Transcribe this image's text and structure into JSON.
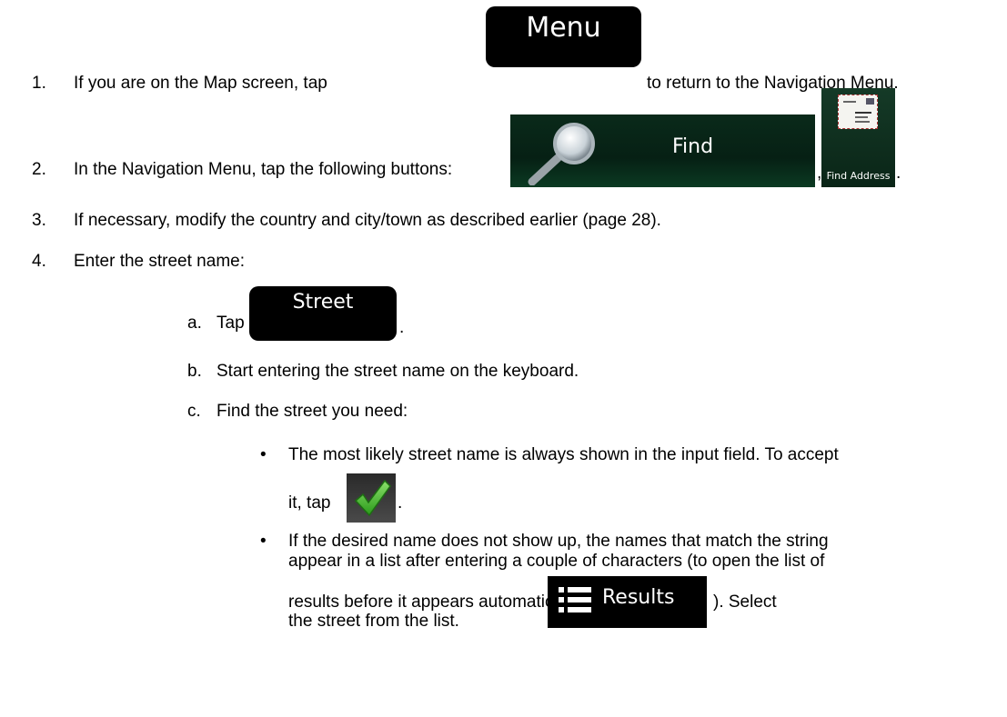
{
  "steps": [
    {
      "num": "1.",
      "before": "If you are on the Map screen, tap",
      "after": "to return to the Navigation Menu."
    },
    {
      "num": "2.",
      "before": "In the Navigation Menu, tap the following buttons:",
      "sep": ",",
      "end": "."
    },
    {
      "num": "3.",
      "text": "If necessary, modify the country and city/town as described earlier (page 28)."
    },
    {
      "num": "4.",
      "text": "Enter the street name:"
    }
  ],
  "substeps": [
    {
      "letter": "a.",
      "before": "Tap",
      "end": "."
    },
    {
      "letter": "b.",
      "text": "Start entering the street name on the keyboard."
    },
    {
      "letter": "c.",
      "text": "Find the street you need:"
    }
  ],
  "bullets": [
    {
      "line1": "The most likely street name is always shown in the input field. To accept",
      "line2": "it, tap",
      "line2_end": "."
    },
    {
      "line1": "If the desired name does not show up, the names that match the string",
      "line2": "appear in a list after entering a couple of characters (to open the list of",
      "line3": "results before it appears automatically, tap",
      "line3_end": "). Select",
      "line4": "the street from the list."
    }
  ],
  "buttons": {
    "menu": "Menu",
    "find": "Find",
    "find_address": "Find Address",
    "street": "Street",
    "accept_icon": "checkmark-icon",
    "results": "Results"
  },
  "colors": {
    "button_black": "#000000",
    "button_green": "#0a2a1a",
    "check_green": "#3cb52a"
  }
}
